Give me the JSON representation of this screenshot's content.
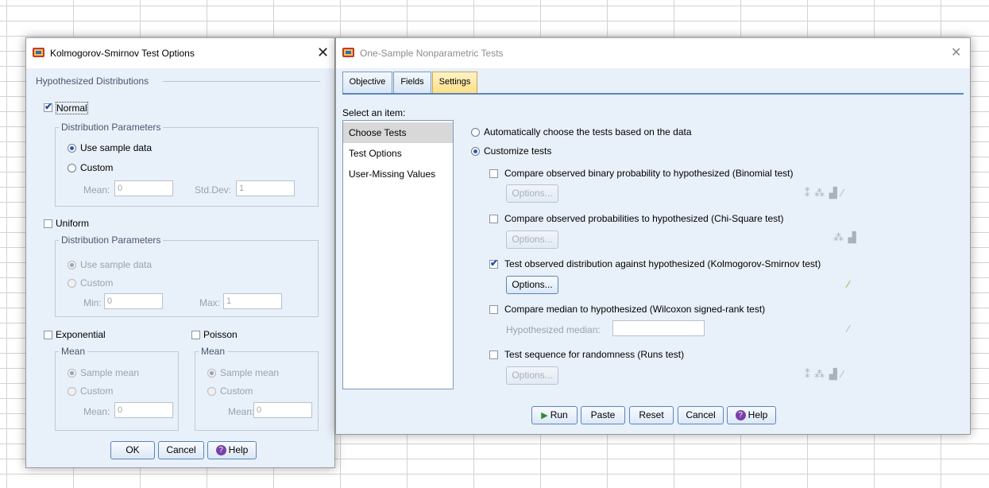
{
  "ks_dialog": {
    "title": "Kolmogorov-Smirnov Test Options",
    "close_glyph": "✕",
    "hypothesized_header": "Hypothesized Distributions",
    "normal": {
      "label": "Normal",
      "checked": true,
      "group_label": "Distribution Parameters",
      "use_sample": "Use sample data",
      "custom": "Custom",
      "mean_label": "Mean:",
      "mean_value": "0",
      "std_label": "Std.Dev:",
      "std_value": "1"
    },
    "uniform": {
      "label": "Uniform",
      "checked": false,
      "group_label": "Distribution Parameters",
      "use_sample": "Use sample data",
      "custom": "Custom",
      "min_label": "Min:",
      "min_value": "0",
      "max_label": "Max:",
      "max_value": "1"
    },
    "exponential": {
      "label": "Exponential",
      "group_label": "Mean",
      "sample_mean": "Sample mean",
      "custom": "Custom",
      "mean_label": "Mean:",
      "mean_value": "0"
    },
    "poisson": {
      "label": "Poisson",
      "group_label": "Mean",
      "sample_mean": "Sample mean",
      "custom": "Custom",
      "mean_label": "Mean:",
      "mean_value": "0"
    },
    "buttons": {
      "ok": "OK",
      "cancel": "Cancel",
      "help": "Help"
    }
  },
  "main_dialog": {
    "title": "One-Sample Nonparametric Tests",
    "close_glyph": "✕",
    "tabs": [
      "Objective",
      "Fields",
      "Settings"
    ],
    "active_tab": "Settings",
    "select_label": "Select an item:",
    "items": [
      "Choose Tests",
      "Test Options",
      "User-Missing Values"
    ],
    "selected_item": "Choose Tests",
    "auto_choose": "Automatically choose the tests based on the data",
    "customize": "Customize tests",
    "tests": [
      {
        "label": "Compare observed binary probability to hypothesized (Binomial test)",
        "checked": false,
        "options": "Options...",
        "icons": "⁑ ⁂ ▟ ⁄"
      },
      {
        "label": "Compare observed probabilities to hypothesized (Chi-Square test)",
        "checked": false,
        "options": "Options...",
        "icons": "⁂ ▟"
      },
      {
        "label": "Test observed distribution against hypothesized (Kolmogorov-Smirnov test)",
        "checked": true,
        "options": "Options...",
        "icons": "⁄"
      },
      {
        "label": "Compare median to hypothesized (Wilcoxon signed-rank test)",
        "checked": false,
        "median_label": "Hypothesized median:",
        "icons": "⁄"
      },
      {
        "label": "Test sequence for randomness (Runs test)",
        "checked": false,
        "options": "Options...",
        "icons": "⁑ ⁂ ▟ ⁄"
      }
    ],
    "buttons": {
      "run": "Run",
      "paste": "Paste",
      "reset": "Reset",
      "cancel": "Cancel",
      "help": "Help"
    }
  }
}
